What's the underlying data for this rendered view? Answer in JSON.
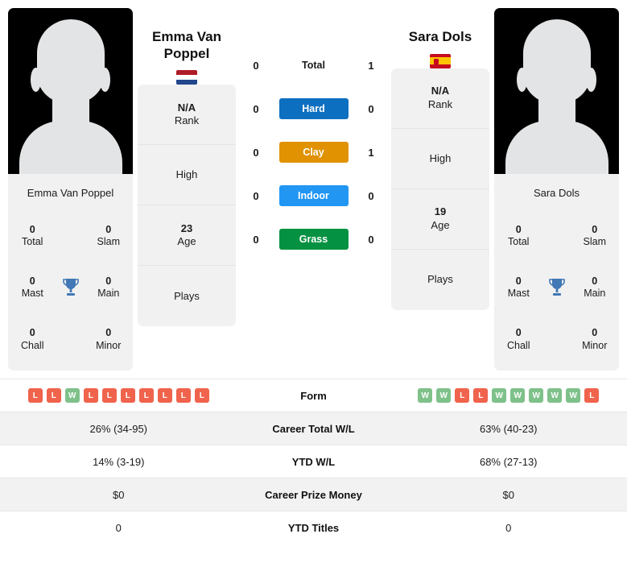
{
  "players": {
    "left": {
      "name": "Emma Van Poppel",
      "name_line1": "Emma Van",
      "name_line2": "Poppel",
      "photo_caption": "Emma Van Poppel",
      "flag": "netherlands-flag",
      "rank_value": "N/A",
      "rank_label": "Rank",
      "high_label": "High",
      "high_value": "",
      "age_value": "23",
      "age_label": "Age",
      "plays_label": "Plays",
      "plays_value": "",
      "titles": {
        "total_value": "0",
        "total_label": "Total",
        "slam_value": "0",
        "slam_label": "Slam",
        "mast_value": "0",
        "mast_label": "Mast",
        "main_value": "0",
        "main_label": "Main",
        "chall_value": "0",
        "chall_label": "Chall",
        "minor_value": "0",
        "minor_label": "Minor"
      },
      "form": [
        "L",
        "L",
        "W",
        "L",
        "L",
        "L",
        "L",
        "L",
        "L",
        "L"
      ],
      "career_total_wl": "26% (34-95)",
      "ytd_wl": "14% (3-19)",
      "career_prize_money": "$0",
      "ytd_titles": "0"
    },
    "right": {
      "name": "Sara Dols",
      "name_line1": "Sara Dols",
      "name_line2": "",
      "photo_caption": "Sara Dols",
      "flag": "spain-flag",
      "rank_value": "N/A",
      "rank_label": "Rank",
      "high_label": "High",
      "high_value": "",
      "age_value": "19",
      "age_label": "Age",
      "plays_label": "Plays",
      "plays_value": "",
      "titles": {
        "total_value": "0",
        "total_label": "Total",
        "slam_value": "0",
        "slam_label": "Slam",
        "mast_value": "0",
        "mast_label": "Mast",
        "main_value": "0",
        "main_label": "Main",
        "chall_value": "0",
        "chall_label": "Chall",
        "minor_value": "0",
        "minor_label": "Minor"
      },
      "form": [
        "W",
        "W",
        "L",
        "L",
        "W",
        "W",
        "W",
        "W",
        "W",
        "L"
      ],
      "career_total_wl": "63% (40-23)",
      "ytd_wl": "68% (27-13)",
      "career_prize_money": "$0",
      "ytd_titles": "0"
    }
  },
  "head_to_head": [
    {
      "label": "Total",
      "left": "0",
      "right": "1",
      "style": "plain",
      "color": ""
    },
    {
      "label": "Hard",
      "left": "0",
      "right": "0",
      "style": "chip",
      "color": "#0d6fc0"
    },
    {
      "label": "Clay",
      "left": "0",
      "right": "1",
      "style": "chip",
      "color": "#e09200"
    },
    {
      "label": "Indoor",
      "left": "0",
      "right": "0",
      "style": "chip",
      "color": "#2196f3"
    },
    {
      "label": "Grass",
      "left": "0",
      "right": "0",
      "style": "chip",
      "color": "#059142"
    }
  ],
  "stats_table": {
    "form_label": "Form",
    "rows": [
      {
        "label": "Career Total W/L",
        "left": "26% (34-95)",
        "right": "63% (40-23)"
      },
      {
        "label": "YTD W/L",
        "left": "14% (3-19)",
        "right": "68% (27-13)"
      },
      {
        "label": "Career Prize Money",
        "left": "$0",
        "right": "$0"
      },
      {
        "label": "YTD Titles",
        "left": "0",
        "right": "0"
      }
    ]
  },
  "colors": {
    "hard": "#0d6fc0",
    "clay": "#e09200",
    "indoor": "#2196f3",
    "grass": "#059142",
    "win_badge": "#7fc18a",
    "loss_badge": "#f0634c",
    "trophy": "#4178b5",
    "card_bg": "#f1f1f1"
  }
}
